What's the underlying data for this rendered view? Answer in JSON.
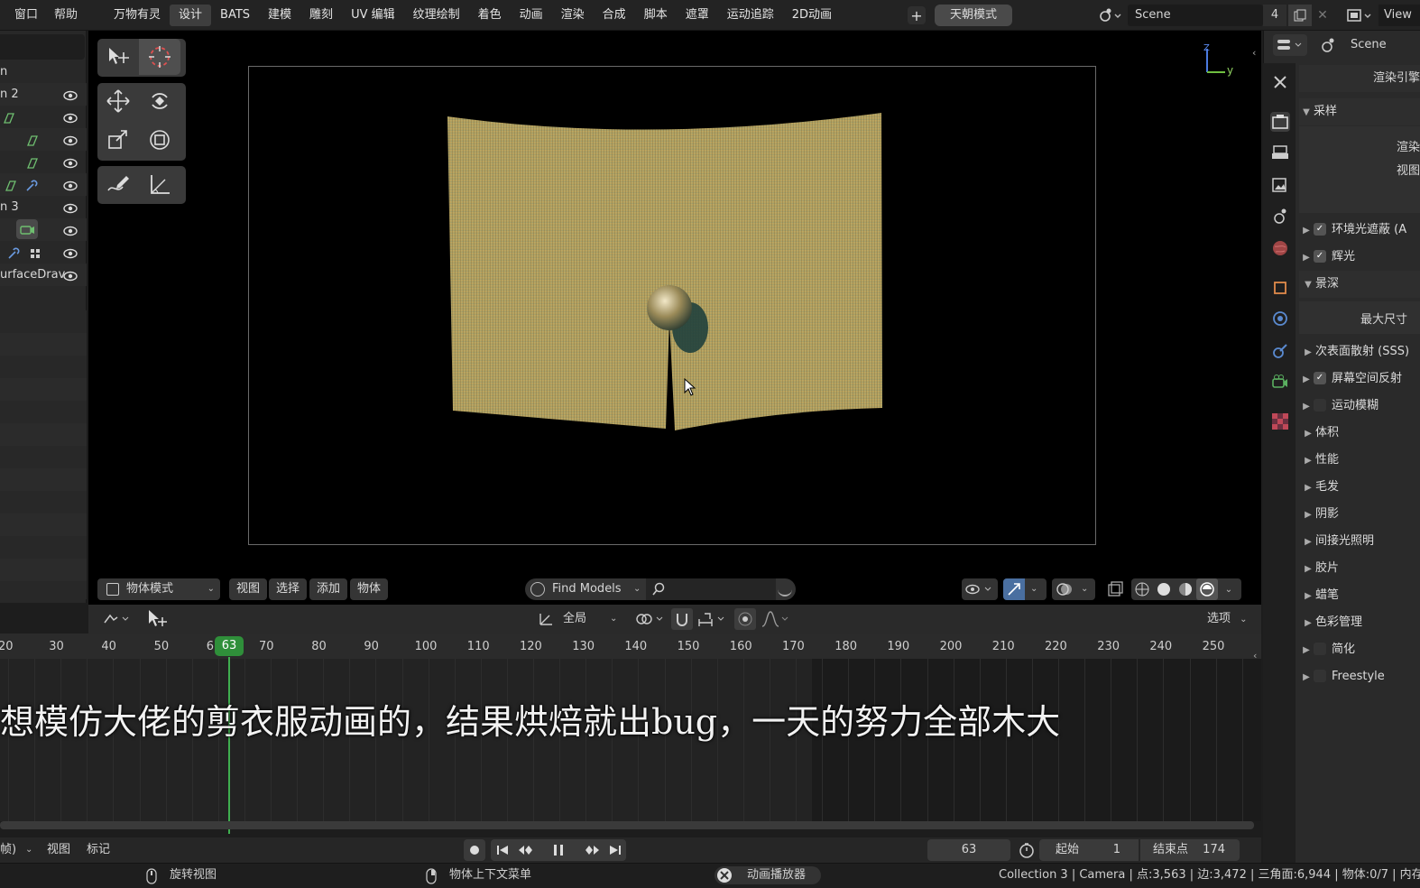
{
  "menus": [
    "窗口",
    "帮助"
  ],
  "workspaces": [
    "万物有灵",
    "设计",
    "BATS",
    "建模",
    "雕刻",
    "UV 编辑",
    "纹理绘制",
    "着色",
    "动画",
    "渲染",
    "合成",
    "脚本",
    "遮罩",
    "运动追踪",
    "2D动画"
  ],
  "active_workspace": "设计",
  "add_workspace": "+",
  "tianchao_button": "天朝模式",
  "scene": {
    "name": "Scene",
    "count": "4"
  },
  "view_button": "View",
  "outliner": {
    "rows": [
      {
        "label": "n"
      },
      {
        "label": "n 2"
      },
      {
        "label": ""
      },
      {
        "label": ""
      },
      {
        "label": ""
      },
      {
        "label": ""
      },
      {
        "label": "n 3"
      },
      {
        "label": ""
      },
      {
        "label": ""
      },
      {
        "label": "urfaceDrav"
      }
    ]
  },
  "viewport_header": {
    "mode": "物体模式",
    "menus": [
      "视图",
      "选择",
      "添加",
      "物体"
    ],
    "find_models": "Find Models",
    "gizmo_axes": {
      "z": "Z",
      "y": "y"
    }
  },
  "timeline_header": {
    "transform_orientation": "全局",
    "options": "选项"
  },
  "ruler": {
    "ticks": [
      "20",
      "30",
      "40",
      "50",
      "6",
      "70",
      "80",
      "90",
      "100",
      "110",
      "120",
      "130",
      "140",
      "150",
      "160",
      "170",
      "180",
      "190",
      "200",
      "210",
      "220",
      "230",
      "240",
      "250"
    ],
    "current_frame": "63"
  },
  "subtitle": "想模仿大佬的剪衣服动画的，结果烘焙就出bug，一天的努力全部木大",
  "playback": {
    "left_menu": "帧)",
    "view": "视图",
    "marker": "标记",
    "current_frame": "63",
    "start_label": "起始",
    "start": "1",
    "end_label": "结束点",
    "end": "174"
  },
  "properties": {
    "header": "Scene",
    "render_engine_label": "渲染引擎",
    "sampling_section": "采样",
    "sampling_render": "渲染",
    "sampling_viewport": "视图",
    "max_size": "最大尺寸",
    "sections": [
      {
        "label": "环境光遮蔽 (A",
        "expanded": false,
        "checkbox": true,
        "checked": true
      },
      {
        "label": "辉光",
        "expanded": false,
        "checkbox": true,
        "checked": true
      },
      {
        "label": "景深",
        "expanded": true,
        "checkbox": false
      },
      {
        "label": "次表面散射 (SSS)",
        "expanded": false,
        "checkbox": false
      },
      {
        "label": "屏幕空间反射",
        "expanded": false,
        "checkbox": true,
        "checked": true
      },
      {
        "label": "运动模糊",
        "expanded": false,
        "checkbox": true,
        "checked": false
      },
      {
        "label": "体积",
        "expanded": false,
        "checkbox": false
      },
      {
        "label": "性能",
        "expanded": false,
        "checkbox": false
      },
      {
        "label": "毛发",
        "expanded": false,
        "checkbox": false
      },
      {
        "label": "阴影",
        "expanded": false,
        "checkbox": false
      },
      {
        "label": "间接光照明",
        "expanded": false,
        "checkbox": false
      },
      {
        "label": "胶片",
        "expanded": false,
        "checkbox": false
      },
      {
        "label": "蜡笔",
        "expanded": false,
        "checkbox": false
      },
      {
        "label": "色彩管理",
        "expanded": false,
        "checkbox": false
      },
      {
        "label": "简化",
        "expanded": false,
        "checkbox": true,
        "checked": false
      },
      {
        "label": "Freestyle",
        "expanded": false,
        "checkbox": true,
        "checked": false
      }
    ]
  },
  "status_bar": {
    "rotate_view": "旋转视图",
    "context_menu": "物体上下文菜单",
    "anim_player": "动画播放器",
    "stats": "Collection 3 | Camera | 点:3,563 | 边:3,472 | 三角面:6,944 | 物体:0/7 | 内存"
  },
  "colors": {
    "accent_green": "#2f8f3a",
    "playhead": "#3fae4f",
    "cloth": "#c9b46a",
    "background": "#000000"
  }
}
